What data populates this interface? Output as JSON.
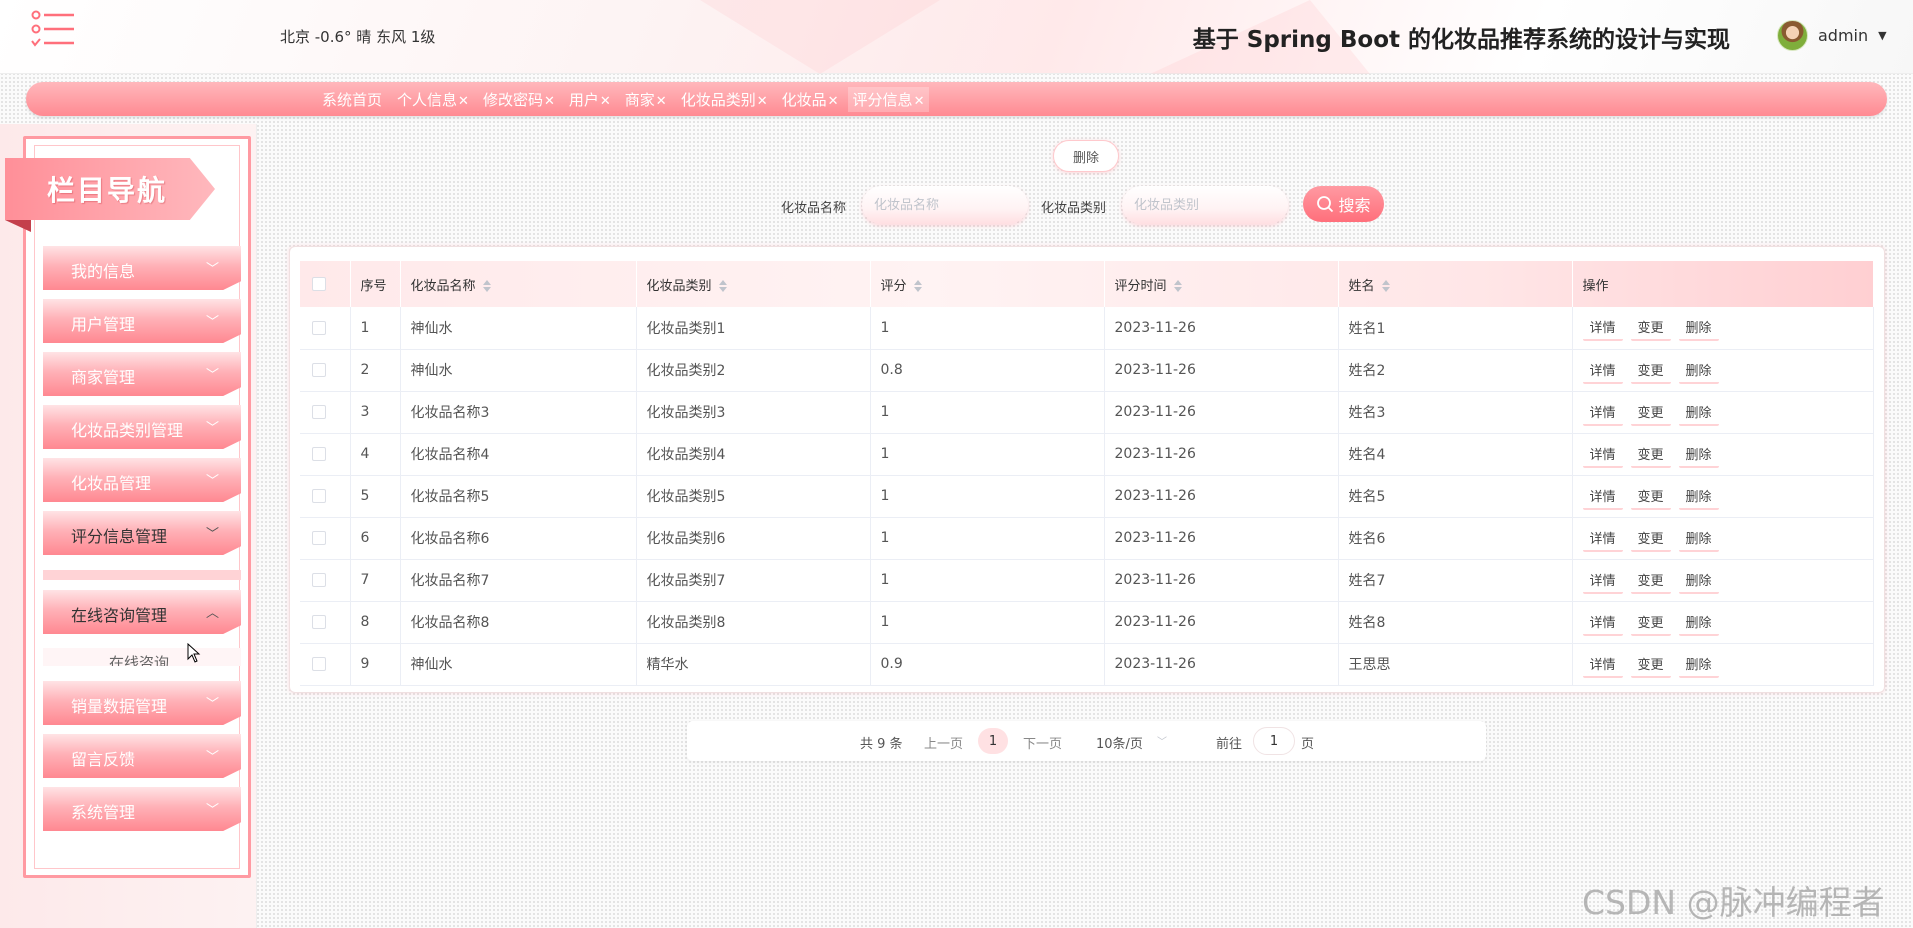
{
  "header": {
    "weather": "北京  -0.6°  晴  东风  1级",
    "title": "基于 Spring Boot 的化妆品推荐系统的设计与实现",
    "user": "admin"
  },
  "tabs": [
    {
      "label": "系统首页",
      "close": ""
    },
    {
      "label": "个人信息",
      "close": "✕"
    },
    {
      "label": "修改密码",
      "close": "✕"
    },
    {
      "label": "用户",
      "close": "✕"
    },
    {
      "label": "商家",
      "close": "✕"
    },
    {
      "label": "化妆品类别",
      "close": "✕"
    },
    {
      "label": "化妆品",
      "close": "✕"
    },
    {
      "label": "评分信息",
      "close": "✕"
    }
  ],
  "sidebar": {
    "title": "栏目导航",
    "items": [
      {
        "label": "我的信息",
        "chevron": "﹀"
      },
      {
        "label": "用户管理",
        "chevron": "﹀"
      },
      {
        "label": "商家管理",
        "chevron": "﹀"
      },
      {
        "label": "化妆品类别管理",
        "chevron": "﹀"
      },
      {
        "label": "化妆品管理",
        "chevron": "﹀"
      },
      {
        "label": "评分信息管理",
        "chevron": "﹀"
      },
      {
        "label": "在线咨询管理",
        "chevron": "︿"
      },
      {
        "label": "销量数据管理",
        "chevron": "﹀"
      },
      {
        "label": "留言反馈",
        "chevron": "﹀"
      },
      {
        "label": "系统管理",
        "chevron": "﹀"
      }
    ],
    "submenu_label": "在线咨询"
  },
  "toolbar": {
    "delete_label": "删除",
    "search_label": "搜索",
    "name_label": "化妆品名称",
    "name_placeholder": "化妆品名称",
    "category_label": "化妆品类别",
    "category_placeholder": "化妆品类别"
  },
  "table": {
    "columns": [
      "序号",
      "化妆品名称",
      "化妆品类别",
      "评分",
      "评分时间",
      "姓名",
      "操作"
    ],
    "rows": [
      [
        "1",
        "神仙水",
        "化妆品类别1",
        "1",
        "2023-11-26",
        "姓名1"
      ],
      [
        "2",
        "神仙水",
        "化妆品类别2",
        "0.8",
        "2023-11-26",
        "姓名2"
      ],
      [
        "3",
        "化妆品名称3",
        "化妆品类别3",
        "1",
        "2023-11-26",
        "姓名3"
      ],
      [
        "4",
        "化妆品名称4",
        "化妆品类别4",
        "1",
        "2023-11-26",
        "姓名4"
      ],
      [
        "5",
        "化妆品名称5",
        "化妆品类别5",
        "1",
        "2023-11-26",
        "姓名5"
      ],
      [
        "6",
        "化妆品名称6",
        "化妆品类别6",
        "1",
        "2023-11-26",
        "姓名6"
      ],
      [
        "7",
        "化妆品名称7",
        "化妆品类别7",
        "1",
        "2023-11-26",
        "姓名7"
      ],
      [
        "8",
        "化妆品名称8",
        "化妆品类别8",
        "1",
        "2023-11-26",
        "姓名8"
      ],
      [
        "9",
        "神仙水",
        "精华水",
        "0.9",
        "2023-11-26",
        "王思思"
      ]
    ],
    "actions": [
      "详情",
      "变更",
      "删除"
    ]
  },
  "pagination": {
    "total": "共 9 条",
    "prev": "上一页",
    "current": "1",
    "next": "下一页",
    "page_size": "10条/页",
    "goto": "前往",
    "goto_value": "1",
    "page_unit": "页"
  },
  "watermark": "CSDN @脉冲编程者",
  "colors": {
    "accent": "#ff8a92",
    "accent_light": "#ffe1e3"
  }
}
